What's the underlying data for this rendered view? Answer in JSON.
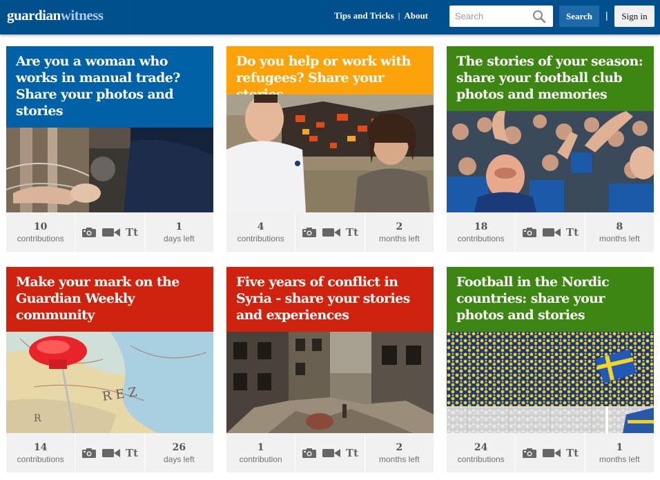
{
  "header": {
    "logo_guardian": "guardian",
    "logo_witness": "witness",
    "nav": [
      {
        "label": "Tips and Tricks"
      },
      {
        "label": "About"
      }
    ],
    "nav_separator": "|",
    "search_placeholder": "Search",
    "search_button": "Search",
    "separator": "|",
    "signin_button": "Sign in"
  },
  "media_text_icon": "Tt",
  "colors": {
    "header": "#00508e",
    "blue": "#0061a6",
    "orange": "#fca20b",
    "green": "#3d8613",
    "red": "#cf2310"
  },
  "cards": [
    {
      "title": "Are you a woman who works in manual trade? Share your photos and stories",
      "color": "#0061a6",
      "image_icon": "worker-with-machinery-photo",
      "contributions": "10",
      "contributions_label": "contributions",
      "time": "1",
      "time_label": "days left"
    },
    {
      "title": "Do you help or work with refugees? Share your stories",
      "color": "#fca20b",
      "image_icon": "volunteers-lifejackets-photo",
      "contributions": "4",
      "contributions_label": "contributions",
      "time": "2",
      "time_label": "months left"
    },
    {
      "title": "The stories of your season: share your football club photos and memories",
      "color": "#3d8613",
      "image_icon": "cheering-fans-photo",
      "contributions": "18",
      "contributions_label": "contributions",
      "time": "8",
      "time_label": "months left"
    },
    {
      "title": "Make your mark on the Guardian Weekly community",
      "color": "#cf2310",
      "image_icon": "map-pushpin-photo",
      "contributions": "14",
      "contributions_label": "contributions",
      "time": "26",
      "time_label": "days left"
    },
    {
      "title": "Five years of conflict in Syria - share your stories and experiences",
      "color": "#cf2310",
      "image_icon": "destroyed-street-photo",
      "contributions": "1",
      "contributions_label": "contribution",
      "time": "2",
      "time_label": "months left"
    },
    {
      "title": "Football in the Nordic countries: share your photos and stories",
      "color": "#3d8613",
      "image_icon": "stadium-crowd-photo",
      "contributions": "24",
      "contributions_label": "contributions",
      "time": "1",
      "time_label": "months left"
    }
  ]
}
